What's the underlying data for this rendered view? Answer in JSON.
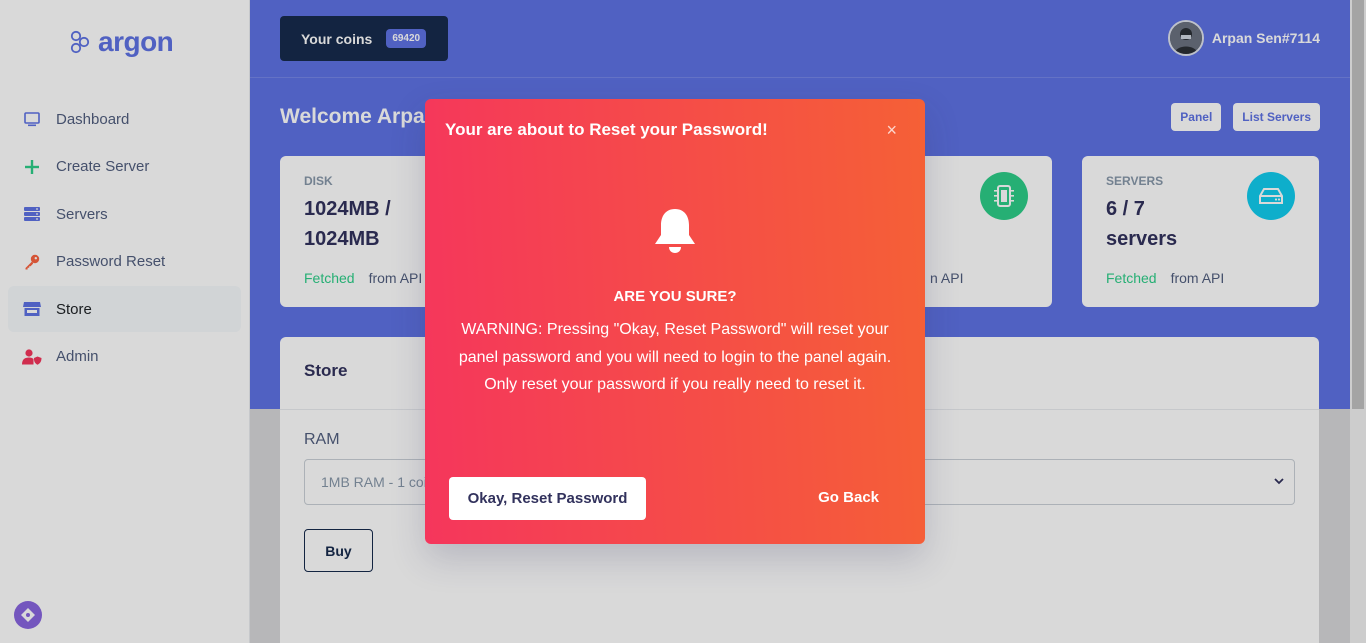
{
  "brand": {
    "name": "argon"
  },
  "sidebar": {
    "items": [
      {
        "label": "Dashboard",
        "icon": "monitor-icon",
        "color": "#5e72e4"
      },
      {
        "label": "Create Server",
        "icon": "plus-icon",
        "color": "#2dce89"
      },
      {
        "label": "Servers",
        "icon": "server-icon",
        "color": "#5e72e4"
      },
      {
        "label": "Password Reset",
        "icon": "key-icon",
        "color": "#f5365c"
      },
      {
        "label": "Store",
        "icon": "store-icon",
        "color": "#5e72e4",
        "active": true
      },
      {
        "label": "Admin",
        "icon": "user-shield-icon",
        "color": "#f5365c"
      }
    ]
  },
  "header": {
    "coins_label": "Your coins",
    "coins_value": "69420",
    "user_name": "Arpan Sen#7114",
    "welcome": "Welcome Arpan",
    "buttons": [
      "Panel",
      "List Servers"
    ]
  },
  "stats": {
    "disk": {
      "title": "DISK",
      "value": "1024MB / 1024MB",
      "status": "Fetched",
      "source": "from API"
    },
    "cpu": {
      "source": "n API",
      "icon": "chip-icon",
      "color": "#2dce89"
    },
    "servers": {
      "title": "SERVERS",
      "value": "6 / 7 servers",
      "status": "Fetched",
      "source": "from API",
      "icon": "drive-icon",
      "color": "#11cdef"
    }
  },
  "store": {
    "title": "Store",
    "ram_label": "RAM",
    "ram_select_value": "1MB RAM - 1 coi",
    "buy_label": "Buy"
  },
  "modal": {
    "title": "Your are about to Reset your Password!",
    "close": "×",
    "heading": "ARE YOU SURE?",
    "body": "WARNING: Pressing \"Okay, Reset Password\" will reset your panel password and you will need to login to the panel again. Only reset your password if you really need to reset it.",
    "confirm_label": "Okay, Reset Password",
    "cancel_label": "Go Back"
  },
  "colors": {
    "primary": "#5e72e4",
    "danger": "#f5365c",
    "success": "#2dce89",
    "info": "#11cdef",
    "dark": "#172b4d"
  }
}
